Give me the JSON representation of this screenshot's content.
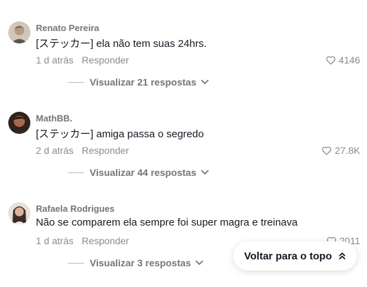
{
  "comments": [
    {
      "username": "Renato Pereira",
      "text": "[ステッカー] ela não tem suas 24hrs.",
      "time": "1 d atrás",
      "reply_label": "Responder",
      "likes": "4146",
      "replies_label": "Visualizar 21 respostas",
      "avatar_colors": [
        "#c9bfb4",
        "#6b5f55"
      ]
    },
    {
      "username": "MathBB.",
      "text": "[ステッカー] amiga passa o segredo",
      "time": "2 d atrás",
      "reply_label": "Responder",
      "likes": "27.8K",
      "replies_label": "Visualizar 44 respostas",
      "avatar_colors": [
        "#3a2a22",
        "#a86b4a"
      ]
    },
    {
      "username": "Rafaela Rodrigues",
      "text": "Não se comparem ela sempre foi super magra e treinava",
      "time": "1 d atrás",
      "reply_label": "Responder",
      "likes": "2011",
      "replies_label": "Visualizar 3 respostas",
      "avatar_colors": [
        "#e3dcd4",
        "#3b2c24"
      ]
    }
  ],
  "back_to_top_label": "Voltar para o topo",
  "icons": {
    "like": "heart-outline-icon",
    "expand": "chevron-down-icon",
    "back_to_top": "double-chevron-up-icon"
  }
}
